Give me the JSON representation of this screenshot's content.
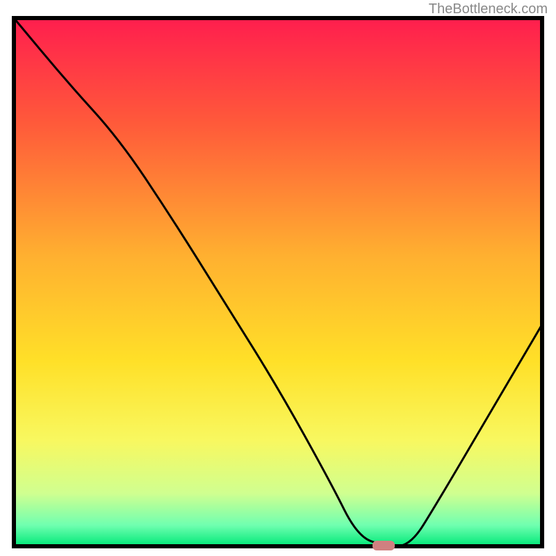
{
  "watermark": "TheBottleneck.com",
  "chart_data": {
    "type": "line",
    "title": "",
    "xlabel": "",
    "ylabel": "",
    "xlim": [
      0,
      100
    ],
    "ylim": [
      0,
      100
    ],
    "series": [
      {
        "name": "bottleneck-curve",
        "x": [
          0,
          10,
          20,
          30,
          40,
          50,
          60,
          65,
          70,
          75,
          80,
          90,
          100
        ],
        "y": [
          100,
          88,
          77,
          62,
          46,
          30,
          12,
          2,
          0,
          0,
          8,
          25,
          42
        ]
      }
    ],
    "marker": {
      "x": 70,
      "y": 0,
      "color": "#d08080"
    },
    "gradient_stops": [
      {
        "offset": 0,
        "color": "#ff1e4e"
      },
      {
        "offset": 20,
        "color": "#ff5a3a"
      },
      {
        "offset": 45,
        "color": "#ffb030"
      },
      {
        "offset": 65,
        "color": "#ffe028"
      },
      {
        "offset": 80,
        "color": "#f8f860"
      },
      {
        "offset": 90,
        "color": "#d0ff90"
      },
      {
        "offset": 96,
        "color": "#70ffb0"
      },
      {
        "offset": 100,
        "color": "#00e878"
      }
    ]
  }
}
